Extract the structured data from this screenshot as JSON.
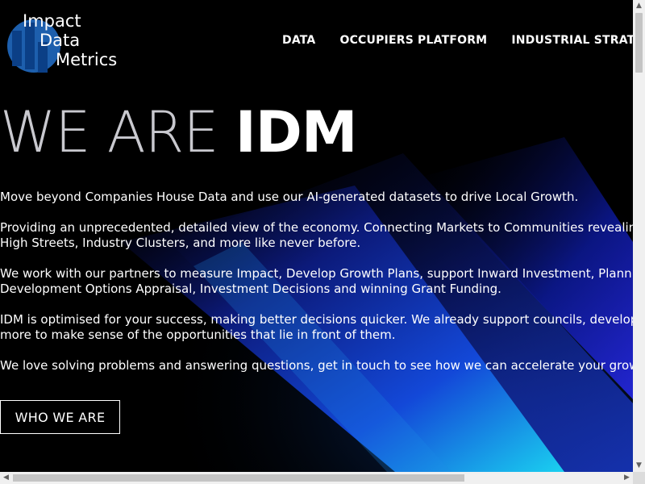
{
  "logo": {
    "lines": [
      "Impact",
      "Data",
      "Metrics"
    ],
    "colors": {
      "primary": "#1d5fad",
      "accent": "#0b3f86"
    }
  },
  "nav": {
    "items": [
      {
        "label": "DATA"
      },
      {
        "label": "OCCUPIERS PLATFORM"
      },
      {
        "label": "INDUSTRIAL STRATEGY SE"
      }
    ]
  },
  "hero": {
    "title_light": "WE ARE ",
    "title_bold": "IDM"
  },
  "paragraphs": [
    {
      "lines": [
        "Move beyond Companies House Data and use our AI-generated datasets to drive Local Growth."
      ]
    },
    {
      "lines": [
        "Providing an unprecedented, detailed view of the economy. Connecting Markets to Communities revealing Lo",
        "High Streets, Industry Clusters, and more like never before."
      ]
    },
    {
      "lines": [
        "We work with our partners to measure Impact, Develop Growth Plans, support Inward Investment, Planning, Co",
        "Development Options Appraisal, Investment Decisions and winning Grant Funding."
      ]
    },
    {
      "lines": [
        "IDM is optimised for your success, making better decisions quicker. We already support councils, developers, u",
        "more to make sense of the opportunities that lie in front of them."
      ]
    },
    {
      "lines": [
        "We love solving problems and answering questions, get in touch to see how we can accelerate your growth by"
      ]
    }
  ],
  "cta": {
    "label": "WHO WE ARE"
  },
  "scrollbars": {
    "vertical": {
      "up_icon": "arrow-up-icon",
      "down_icon": "arrow-down-icon"
    },
    "horizontal": {
      "left_icon": "arrow-left-icon",
      "right_icon": "arrow-right-icon"
    }
  },
  "colors": {
    "background": "#000000",
    "glow_blue": "#1a4cff",
    "glow_cyan": "#19c8f0"
  }
}
